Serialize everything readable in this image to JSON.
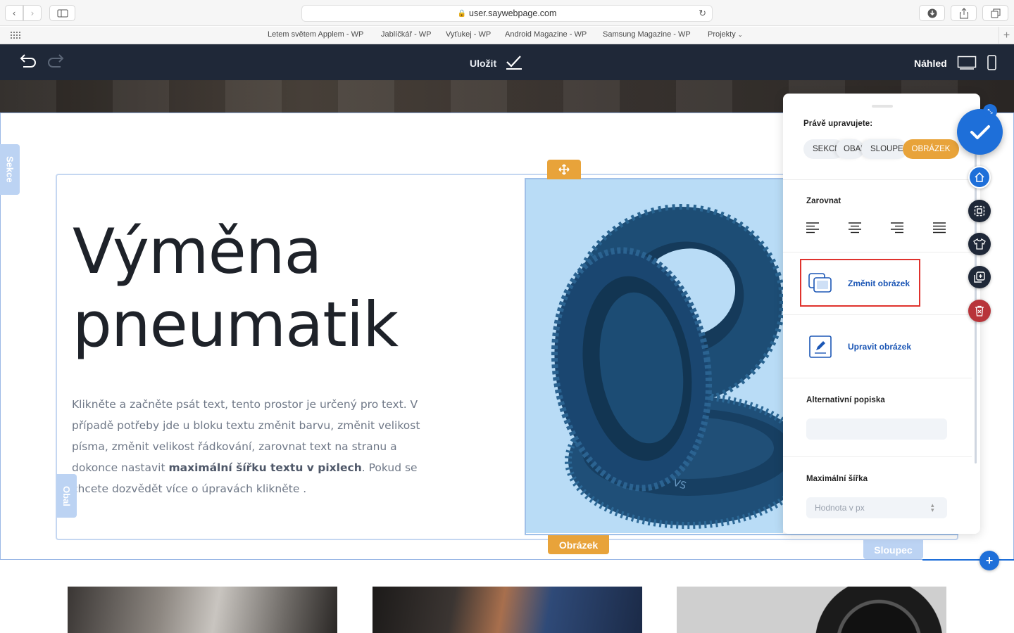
{
  "browser": {
    "url": "user.saywebpage.com",
    "bookmarks": [
      "Letem světem Applem - WP",
      "Jablíčkář - WP",
      "Vyťukej - WP",
      "Android Magazine - WP",
      "Samsung Magazine - WP",
      "Projekty"
    ]
  },
  "editor": {
    "save_label": "Uložit",
    "preview_label": "Náhled"
  },
  "page": {
    "heading_line1": "Výměna",
    "heading_line2": "pneumatik",
    "para_part1": "Klikněte a začněte psát text, tento prostor je určený pro text. V případě potřeby jde u bloku textu změnit barvu, změnit velikost písma, změnit velikost řádkování, zarovnat text na stranu a dokonce nastavit ",
    "para_bold": "maximální šířku textu v pixlech",
    "para_part2": ". Pokud se chcete dozvědět více o úpravách klikněte .",
    "tab_section": "Sekce",
    "tab_wrapper": "Obal",
    "tag_image": "Obrázek",
    "tag_column": "Sloupec"
  },
  "panel": {
    "editing_label": "Právě upravujete:",
    "breadcrumbs": [
      "SEKCE",
      "OBAL",
      "SLOUPEC",
      "OBRÁZEK"
    ],
    "align_label": "Zarovnat",
    "change_image": "Změnit obrázek",
    "edit_image": "Upravit obrázek",
    "alt_label": "Alternativní popiska",
    "alt_value": "",
    "max_width_label": "Maximální šířka",
    "max_width_placeholder": "Hodnota v px"
  },
  "colors": {
    "accent_orange": "#e8a33a",
    "accent_blue": "#1e6fd9",
    "editor_bar": "#1f2838",
    "highlight_red": "#e0322d",
    "delete_red": "#b8343a"
  },
  "icons": [
    "back-icon",
    "forward-icon",
    "sidebar-icon",
    "lock-icon",
    "reload-icon",
    "download-icon",
    "share-icon",
    "tabs-icon",
    "grid-icon",
    "undo-icon",
    "redo-icon",
    "check-icon",
    "desktop-icon",
    "mobile-icon",
    "move-icon",
    "home-icon",
    "select-icon",
    "shirt-icon",
    "duplicate-icon",
    "trash-icon"
  ]
}
